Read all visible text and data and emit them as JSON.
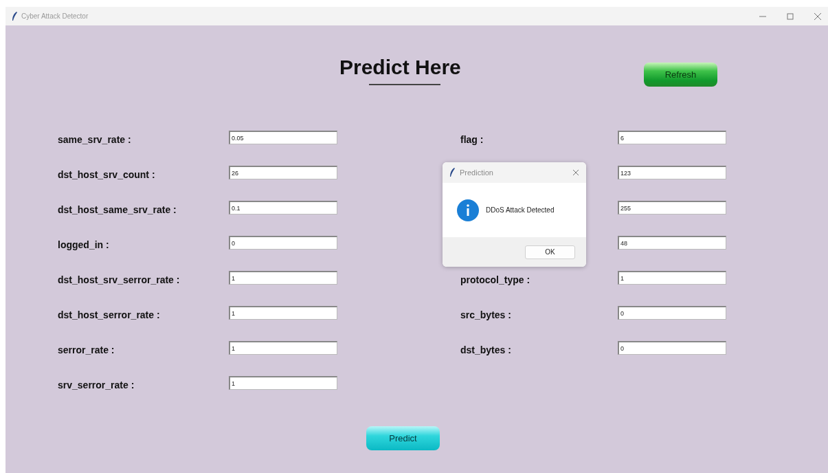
{
  "window": {
    "title": "Cyber Attack Detector"
  },
  "heading": "Predict Here",
  "refresh_button": "Refresh",
  "fields_left": [
    {
      "label": "same_srv_rate :",
      "value": "0.05"
    },
    {
      "label": "dst_host_srv_count :",
      "value": "26"
    },
    {
      "label": "dst_host_same_srv_rate :",
      "value": "0.1"
    },
    {
      "label": "logged_in :",
      "value": "0"
    },
    {
      "label": "dst_host_srv_serror_rate :",
      "value": "1"
    },
    {
      "label": "dst_host_serror_rate :",
      "value": "1"
    },
    {
      "label": "serror_rate :",
      "value": "1"
    },
    {
      "label": "srv_serror_rate :",
      "value": "1"
    }
  ],
  "fields_right": [
    {
      "label": "flag :",
      "value": "6"
    },
    {
      "value": "123"
    },
    {
      "value": "255"
    },
    {
      "value": "48"
    },
    {
      "label": "protocol_type :",
      "value": "1"
    },
    {
      "label": "src_bytes :",
      "value": "0"
    },
    {
      "label": "dst_bytes :",
      "value": "0"
    }
  ],
  "predict_button": "Predict",
  "dialog": {
    "title": "Prediction",
    "message": "DDoS Attack Detected",
    "button": "OK"
  }
}
